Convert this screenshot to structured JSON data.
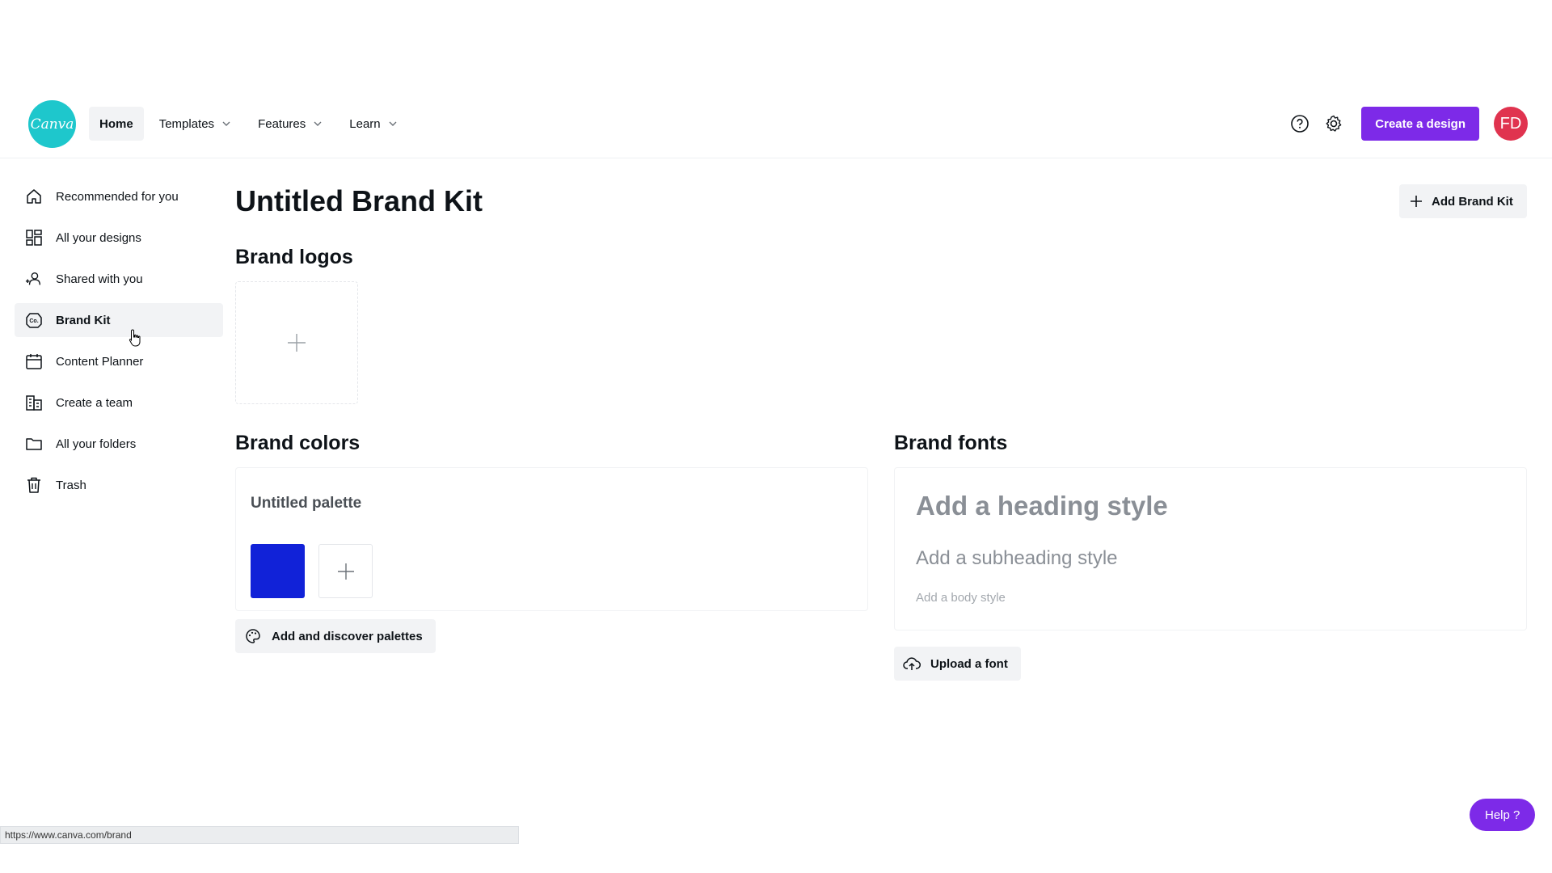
{
  "header": {
    "logo_text": "Canva",
    "nav": [
      {
        "label": "Home",
        "active": true,
        "dropdown": false
      },
      {
        "label": "Templates",
        "dropdown": true
      },
      {
        "label": "Features",
        "dropdown": true
      },
      {
        "label": "Learn",
        "dropdown": true
      }
    ],
    "create_label": "Create a design",
    "avatar_initials": "FD",
    "accent": "#7d2ae8",
    "avatar_color": "#e0334f",
    "icons": [
      "help-circle-icon",
      "settings-gear-icon"
    ]
  },
  "sidebar": {
    "items": [
      {
        "label": "Recommended for you",
        "icon": "home-icon"
      },
      {
        "label": "All your designs",
        "icon": "grid-icon"
      },
      {
        "label": "Shared with you",
        "icon": "shared-people-icon"
      },
      {
        "label": "Brand Kit",
        "icon": "brand-kit-icon",
        "active": true
      },
      {
        "label": "Content Planner",
        "icon": "calendar-icon"
      },
      {
        "label": "Create a team",
        "icon": "team-building-icon"
      },
      {
        "label": "All your folders",
        "icon": "folder-icon"
      },
      {
        "label": "Trash",
        "icon": "trash-icon"
      }
    ]
  },
  "main": {
    "title": "Untitled Brand Kit",
    "add_brand_kit": "Add Brand Kit",
    "logos": {
      "title": "Brand logos"
    },
    "colors": {
      "title": "Brand colors",
      "palette_name": "Untitled palette",
      "swatches": [
        "#1122d8"
      ],
      "discover_label": "Add and discover palettes"
    },
    "fonts": {
      "title": "Brand fonts",
      "heading": "Add a heading style",
      "subheading": "Add a subheading style",
      "body": "Add a body style",
      "upload_label": "Upload a font"
    }
  },
  "status_url": "https://www.canva.com/brand",
  "help_label": "Help ?"
}
